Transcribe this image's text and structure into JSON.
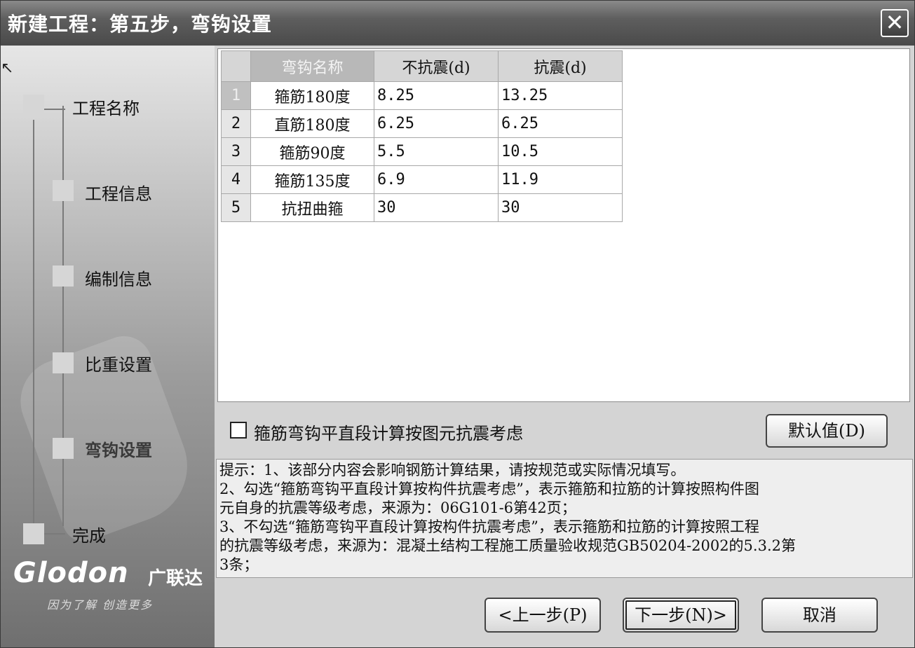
{
  "window": {
    "title": "新建工程：第五步，弯钩设置",
    "close_glyph": "✕"
  },
  "sidebar": {
    "steps": [
      {
        "label": "工程名称"
      },
      {
        "label": "工程信息"
      },
      {
        "label": "编制信息"
      },
      {
        "label": "比重设置"
      },
      {
        "label": "弯钩设置"
      },
      {
        "label": "完成"
      }
    ],
    "current_step": "弯钩设置",
    "logo_text": "Glodon",
    "logo_cn": "广联达",
    "slogan": "因为了解 创造更多"
  },
  "table": {
    "headers": [
      "弯钩名称",
      "不抗震(d)",
      "抗震(d)"
    ],
    "rows": [
      {
        "num": "1",
        "name": "箍筋180度",
        "non_seismic": "8.25",
        "seismic": "13.25"
      },
      {
        "num": "2",
        "name": "直筋180度",
        "non_seismic": "6.25",
        "seismic": "6.25"
      },
      {
        "num": "3",
        "name": "箍筋90度",
        "non_seismic": "5.5",
        "seismic": "10.5"
      },
      {
        "num": "4",
        "name": "箍筋135度",
        "non_seismic": "6.9",
        "seismic": "11.9"
      },
      {
        "num": "5",
        "name": "抗扭曲箍",
        "non_seismic": "30",
        "seismic": "30"
      }
    ],
    "selected_row": 1
  },
  "options": {
    "checkbox_label": "箍筋弯钩平直段计算按图元抗震考虑",
    "checkbox_checked": false,
    "default_button": "默认值(D)"
  },
  "hint": {
    "lines": [
      "提示：1、该部分内容会影响钢筋计算结果，请按规范或实际情况填写。",
      "2、勾选“箍筋弯钩平直段计算按构件抗震考虑”，表示箍筋和拉筋的计算按照构件图",
      "元自身的抗震等级考虑，来源为：06G101-6第42页；",
      "3、不勾选“箍筋弯钩平直段计算按构件抗震考虑”，表示箍筋和拉筋的计算按照工程",
      "的抗震等级考虑，来源为：混凝土结构工程施工质量验收规范GB50204-2002的5.3.2第",
      "3条；"
    ]
  },
  "footer": {
    "prev_button": "<上一步(P)",
    "next_button": "下一步(N)>",
    "cancel_button": "取消"
  }
}
